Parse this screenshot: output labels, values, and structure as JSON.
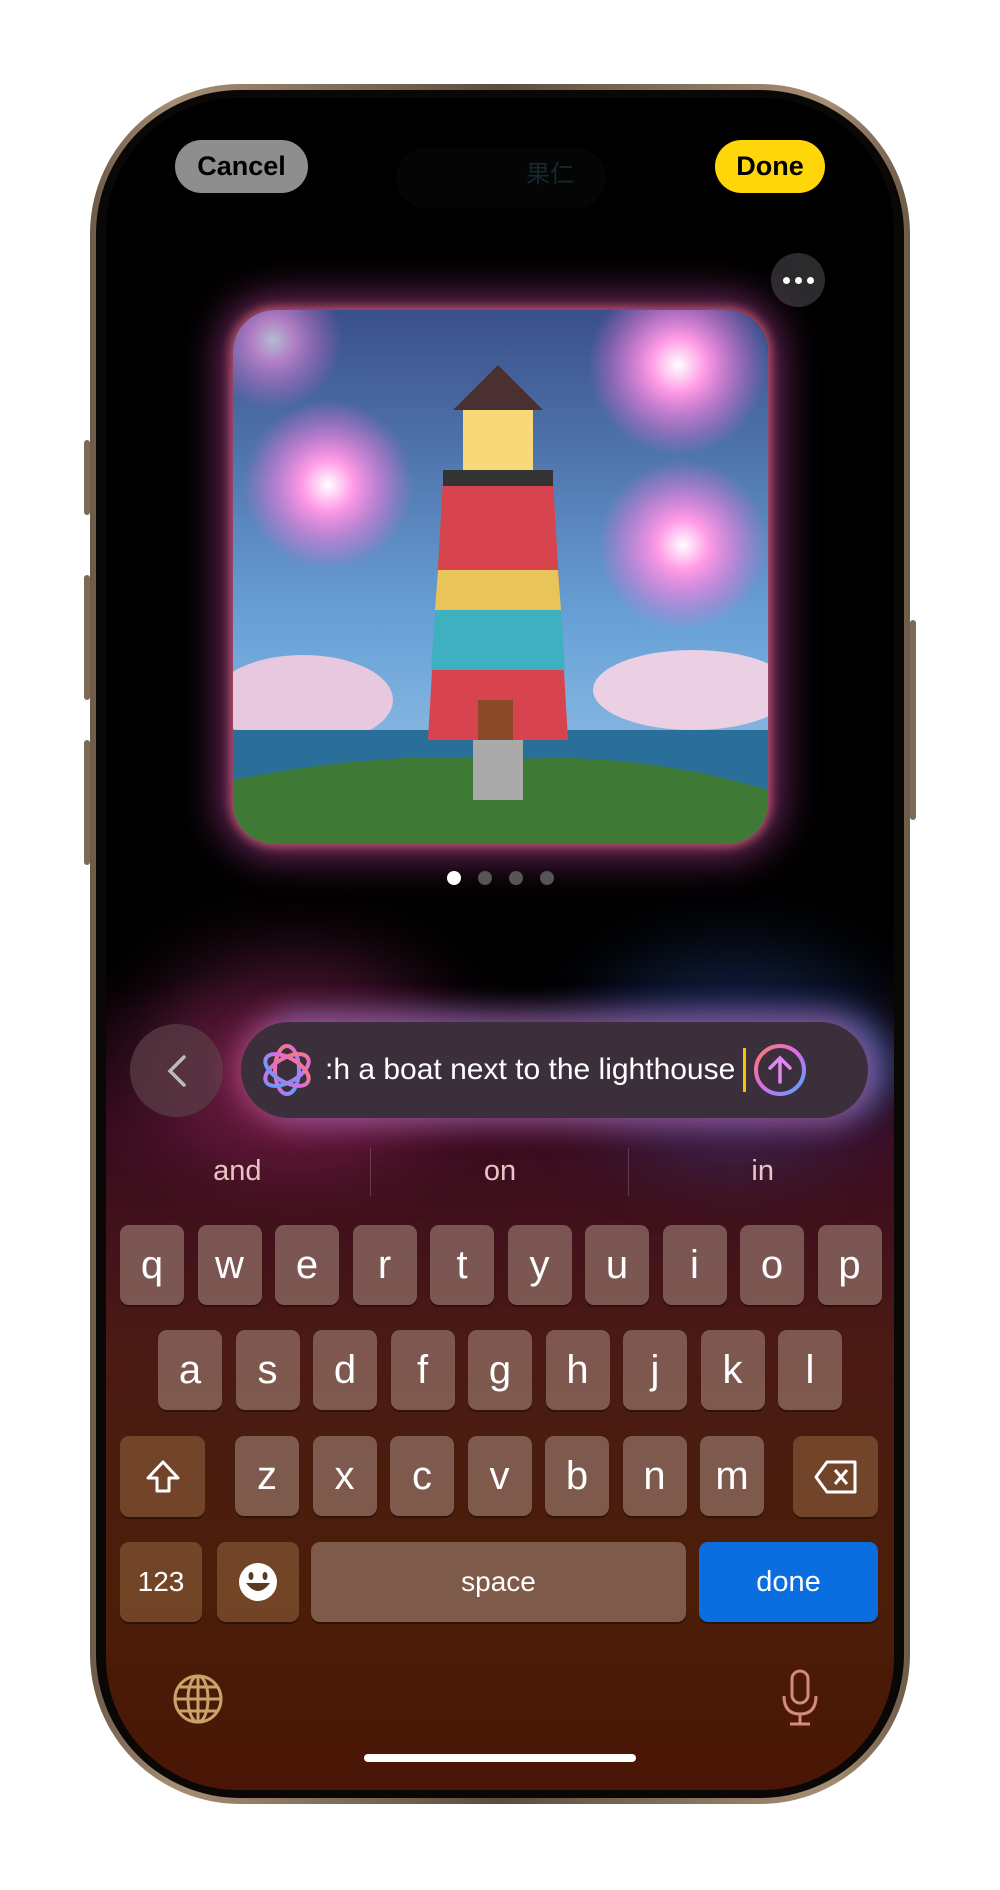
{
  "header": {
    "cancel_label": "Cancel",
    "done_label": "Done",
    "ghost_text": "果仁",
    "more_icon": "ellipsis-icon"
  },
  "colors": {
    "done_pill": "#ffd60a",
    "cancel_pill": "#8e8e8e",
    "keyboard_done": "#0a6ee0"
  },
  "carousel": {
    "page_count": 4,
    "current_page": 1
  },
  "prompt": {
    "text": ":h a boat next to the lighthouse",
    "left_icon": "image-playground-icon",
    "send_icon": "arrow-up-circle-icon",
    "back_icon": "chevron-left-icon"
  },
  "suggestions": [
    "and",
    "on",
    "in"
  ],
  "keyboard": {
    "row1": [
      "q",
      "w",
      "e",
      "r",
      "t",
      "y",
      "u",
      "i",
      "o",
      "p"
    ],
    "row2": [
      "a",
      "s",
      "d",
      "f",
      "g",
      "h",
      "j",
      "k",
      "l"
    ],
    "row3": [
      "z",
      "x",
      "c",
      "v",
      "b",
      "n",
      "m"
    ],
    "numbers_label": "123",
    "space_label": "space",
    "done_label": "done",
    "shift_icon": "shift-icon",
    "delete_icon": "delete-icon",
    "emoji_icon": "emoji-icon",
    "globe_icon": "globe-icon",
    "mic_icon": "microphone-icon"
  }
}
